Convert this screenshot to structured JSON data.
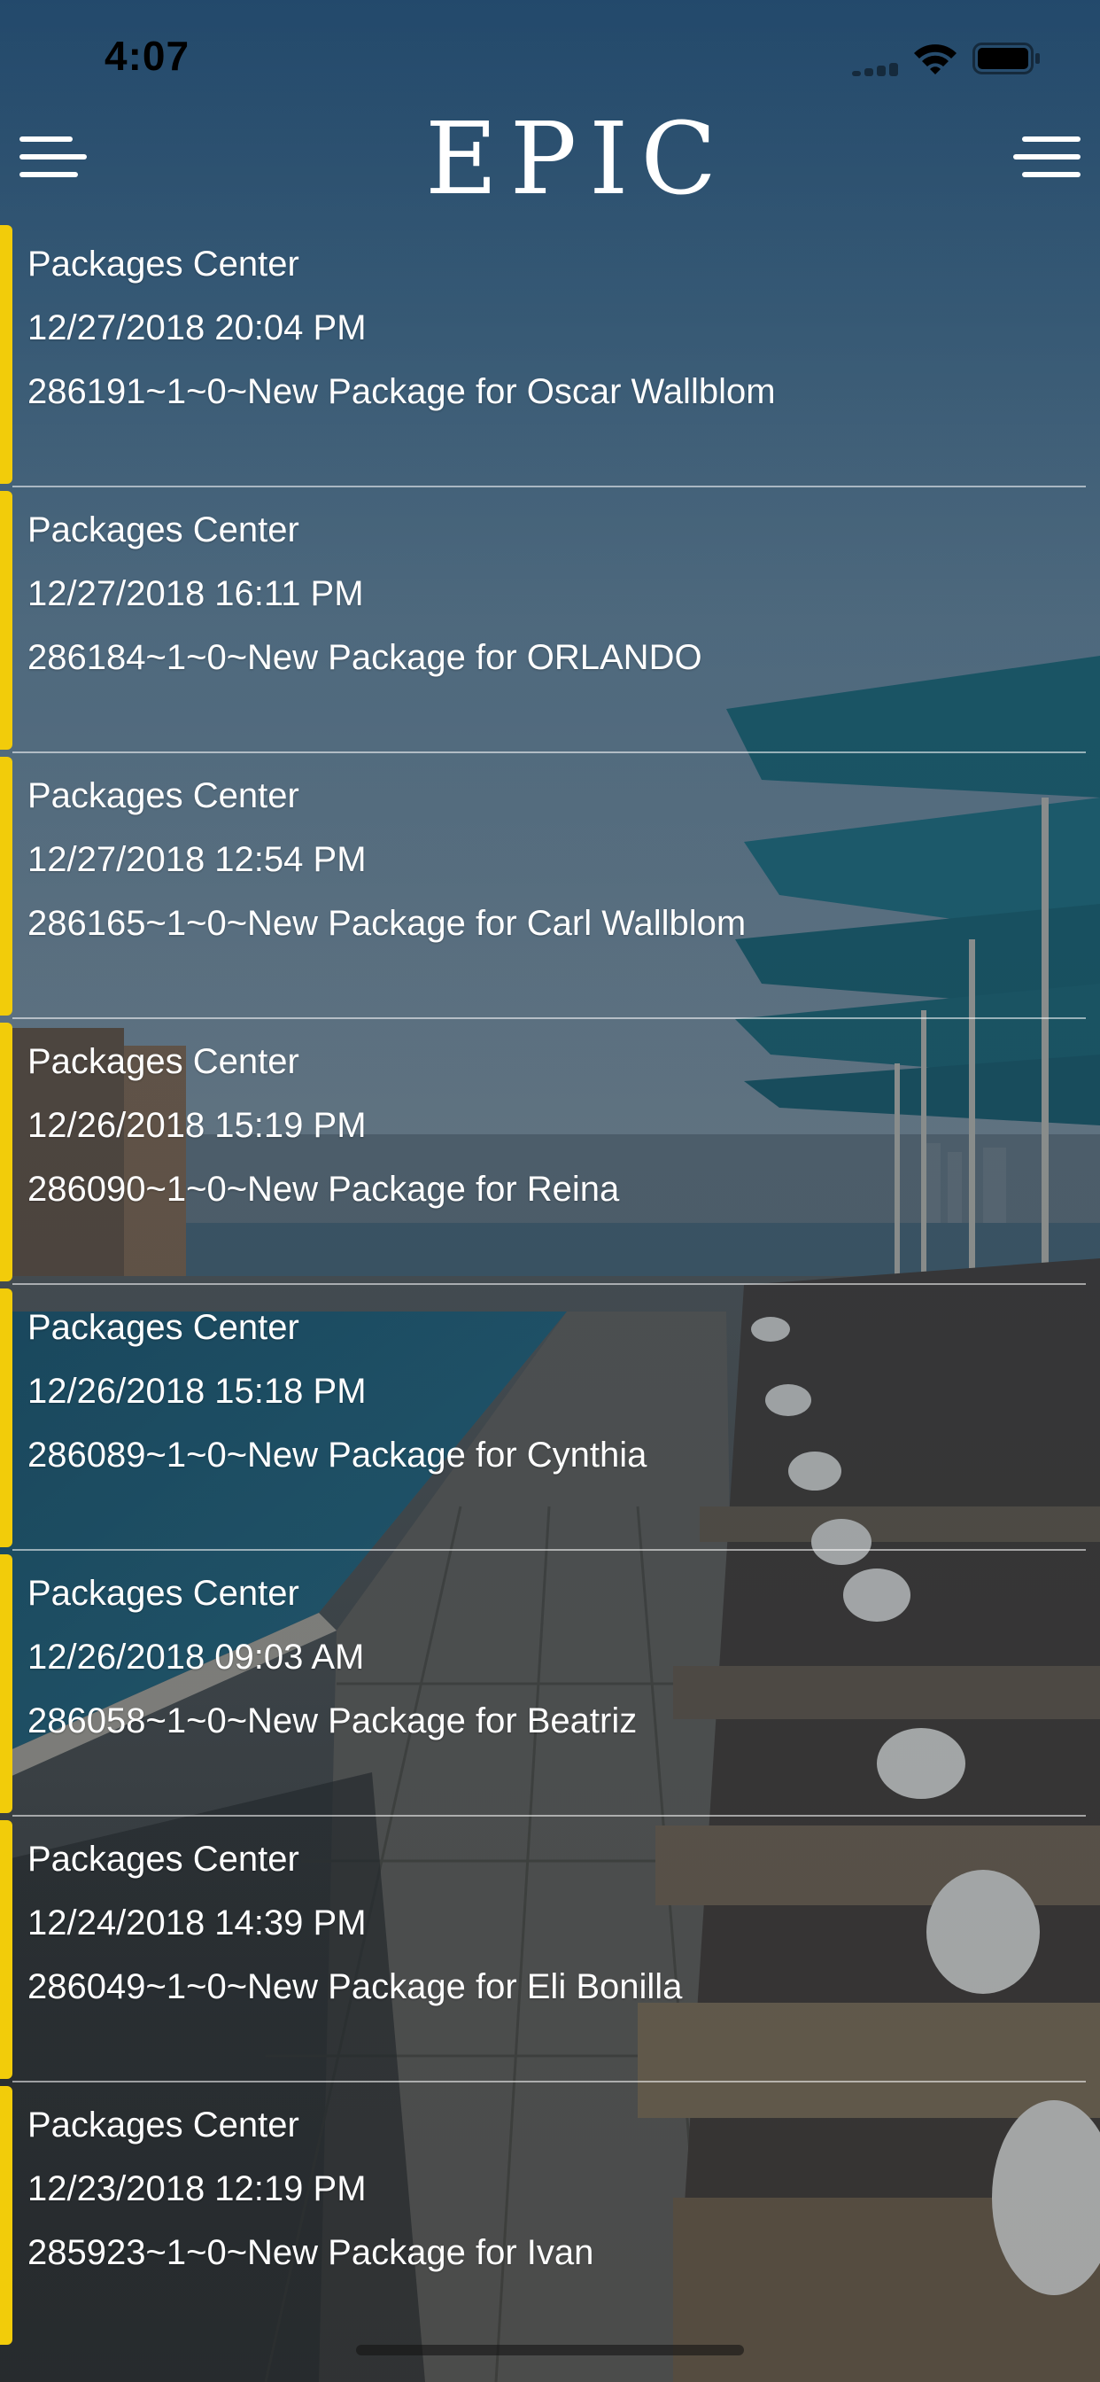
{
  "status_bar": {
    "time": "4:07",
    "icons": [
      "cellular-signal-icon",
      "wifi-icon",
      "battery-icon"
    ]
  },
  "header": {
    "logo_text": "EPIC",
    "left_icon": "hamburger-menu-icon",
    "right_icon": "hamburger-menu-icon"
  },
  "colors": {
    "accent": "#f2cc0a",
    "text": "#ffffff",
    "divider": "#ffffff"
  },
  "notifications": [
    {
      "source": "Packages Center",
      "datetime": "12/27/2018 20:04 PM",
      "message": "286191~1~0~New Package for Oscar Wallblom"
    },
    {
      "source": "Packages Center",
      "datetime": "12/27/2018 16:11 PM",
      "message": "286184~1~0~New Package for ORLANDO"
    },
    {
      "source": "Packages Center",
      "datetime": "12/27/2018 12:54 PM",
      "message": "286165~1~0~New Package for Carl Wallblom"
    },
    {
      "source": "Packages Center",
      "datetime": "12/26/2018 15:19 PM",
      "message": "286090~1~0~New Package for Reina"
    },
    {
      "source": "Packages Center",
      "datetime": "12/26/2018 15:18 PM",
      "message": "286089~1~0~New Package for Cynthia"
    },
    {
      "source": "Packages Center",
      "datetime": "12/26/2018 09:03 AM",
      "message": "286058~1~0~New Package for Beatriz"
    },
    {
      "source": "Packages Center",
      "datetime": "12/24/2018 14:39 PM",
      "message": "286049~1~0~New Package for Eli Bonilla"
    },
    {
      "source": "Packages Center",
      "datetime": "12/23/2018 12:19 PM",
      "message": "285923~1~0~New Package for Ivan"
    }
  ]
}
